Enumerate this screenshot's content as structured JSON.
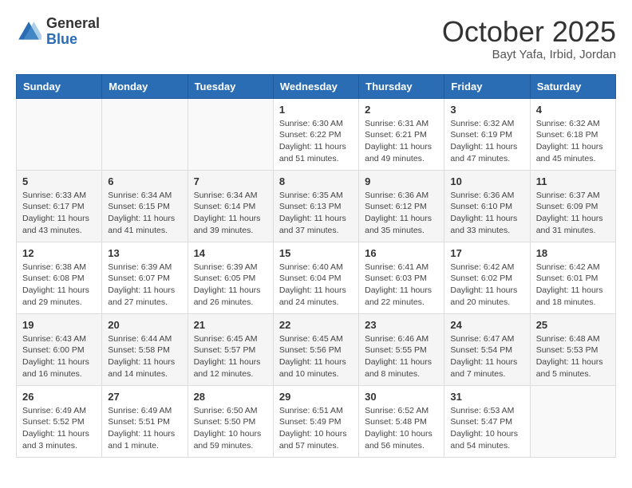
{
  "header": {
    "logo_line1": "General",
    "logo_line2": "Blue",
    "month": "October 2025",
    "location": "Bayt Yafa, Irbid, Jordan"
  },
  "weekdays": [
    "Sunday",
    "Monday",
    "Tuesday",
    "Wednesday",
    "Thursday",
    "Friday",
    "Saturday"
  ],
  "weeks": [
    [
      {
        "day": "",
        "info": ""
      },
      {
        "day": "",
        "info": ""
      },
      {
        "day": "",
        "info": ""
      },
      {
        "day": "1",
        "info": "Sunrise: 6:30 AM\nSunset: 6:22 PM\nDaylight: 11 hours\nand 51 minutes."
      },
      {
        "day": "2",
        "info": "Sunrise: 6:31 AM\nSunset: 6:21 PM\nDaylight: 11 hours\nand 49 minutes."
      },
      {
        "day": "3",
        "info": "Sunrise: 6:32 AM\nSunset: 6:19 PM\nDaylight: 11 hours\nand 47 minutes."
      },
      {
        "day": "4",
        "info": "Sunrise: 6:32 AM\nSunset: 6:18 PM\nDaylight: 11 hours\nand 45 minutes."
      }
    ],
    [
      {
        "day": "5",
        "info": "Sunrise: 6:33 AM\nSunset: 6:17 PM\nDaylight: 11 hours\nand 43 minutes."
      },
      {
        "day": "6",
        "info": "Sunrise: 6:34 AM\nSunset: 6:15 PM\nDaylight: 11 hours\nand 41 minutes."
      },
      {
        "day": "7",
        "info": "Sunrise: 6:34 AM\nSunset: 6:14 PM\nDaylight: 11 hours\nand 39 minutes."
      },
      {
        "day": "8",
        "info": "Sunrise: 6:35 AM\nSunset: 6:13 PM\nDaylight: 11 hours\nand 37 minutes."
      },
      {
        "day": "9",
        "info": "Sunrise: 6:36 AM\nSunset: 6:12 PM\nDaylight: 11 hours\nand 35 minutes."
      },
      {
        "day": "10",
        "info": "Sunrise: 6:36 AM\nSunset: 6:10 PM\nDaylight: 11 hours\nand 33 minutes."
      },
      {
        "day": "11",
        "info": "Sunrise: 6:37 AM\nSunset: 6:09 PM\nDaylight: 11 hours\nand 31 minutes."
      }
    ],
    [
      {
        "day": "12",
        "info": "Sunrise: 6:38 AM\nSunset: 6:08 PM\nDaylight: 11 hours\nand 29 minutes."
      },
      {
        "day": "13",
        "info": "Sunrise: 6:39 AM\nSunset: 6:07 PM\nDaylight: 11 hours\nand 27 minutes."
      },
      {
        "day": "14",
        "info": "Sunrise: 6:39 AM\nSunset: 6:05 PM\nDaylight: 11 hours\nand 26 minutes."
      },
      {
        "day": "15",
        "info": "Sunrise: 6:40 AM\nSunset: 6:04 PM\nDaylight: 11 hours\nand 24 minutes."
      },
      {
        "day": "16",
        "info": "Sunrise: 6:41 AM\nSunset: 6:03 PM\nDaylight: 11 hours\nand 22 minutes."
      },
      {
        "day": "17",
        "info": "Sunrise: 6:42 AM\nSunset: 6:02 PM\nDaylight: 11 hours\nand 20 minutes."
      },
      {
        "day": "18",
        "info": "Sunrise: 6:42 AM\nSunset: 6:01 PM\nDaylight: 11 hours\nand 18 minutes."
      }
    ],
    [
      {
        "day": "19",
        "info": "Sunrise: 6:43 AM\nSunset: 6:00 PM\nDaylight: 11 hours\nand 16 minutes."
      },
      {
        "day": "20",
        "info": "Sunrise: 6:44 AM\nSunset: 5:58 PM\nDaylight: 11 hours\nand 14 minutes."
      },
      {
        "day": "21",
        "info": "Sunrise: 6:45 AM\nSunset: 5:57 PM\nDaylight: 11 hours\nand 12 minutes."
      },
      {
        "day": "22",
        "info": "Sunrise: 6:45 AM\nSunset: 5:56 PM\nDaylight: 11 hours\nand 10 minutes."
      },
      {
        "day": "23",
        "info": "Sunrise: 6:46 AM\nSunset: 5:55 PM\nDaylight: 11 hours\nand 8 minutes."
      },
      {
        "day": "24",
        "info": "Sunrise: 6:47 AM\nSunset: 5:54 PM\nDaylight: 11 hours\nand 7 minutes."
      },
      {
        "day": "25",
        "info": "Sunrise: 6:48 AM\nSunset: 5:53 PM\nDaylight: 11 hours\nand 5 minutes."
      }
    ],
    [
      {
        "day": "26",
        "info": "Sunrise: 6:49 AM\nSunset: 5:52 PM\nDaylight: 11 hours\nand 3 minutes."
      },
      {
        "day": "27",
        "info": "Sunrise: 6:49 AM\nSunset: 5:51 PM\nDaylight: 11 hours\nand 1 minute."
      },
      {
        "day": "28",
        "info": "Sunrise: 6:50 AM\nSunset: 5:50 PM\nDaylight: 10 hours\nand 59 minutes."
      },
      {
        "day": "29",
        "info": "Sunrise: 6:51 AM\nSunset: 5:49 PM\nDaylight: 10 hours\nand 57 minutes."
      },
      {
        "day": "30",
        "info": "Sunrise: 6:52 AM\nSunset: 5:48 PM\nDaylight: 10 hours\nand 56 minutes."
      },
      {
        "day": "31",
        "info": "Sunrise: 6:53 AM\nSunset: 5:47 PM\nDaylight: 10 hours\nand 54 minutes."
      },
      {
        "day": "",
        "info": ""
      }
    ]
  ]
}
